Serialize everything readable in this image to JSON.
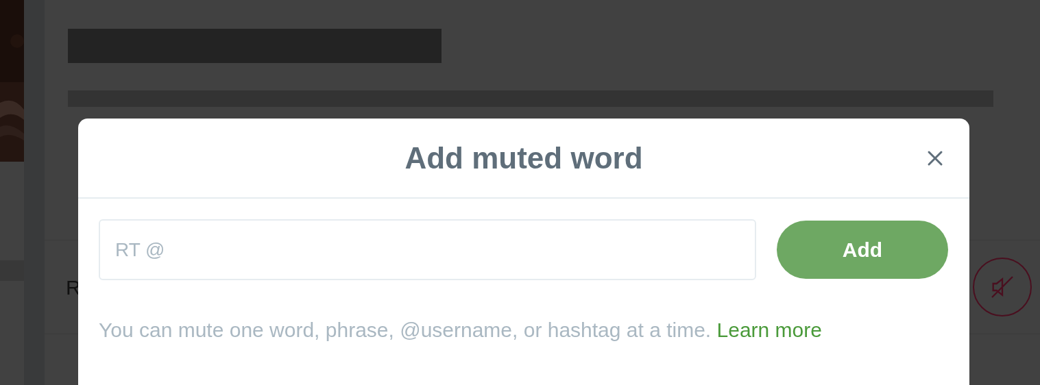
{
  "background": {
    "row": {
      "text": "R"
    }
  },
  "dialog": {
    "title": "Add muted word",
    "input": {
      "placeholder": "RT @"
    },
    "add_button": "Add",
    "help": {
      "text": "You can mute one word, phrase, @username, or hashtag at a time.",
      "link": "Learn more"
    }
  }
}
